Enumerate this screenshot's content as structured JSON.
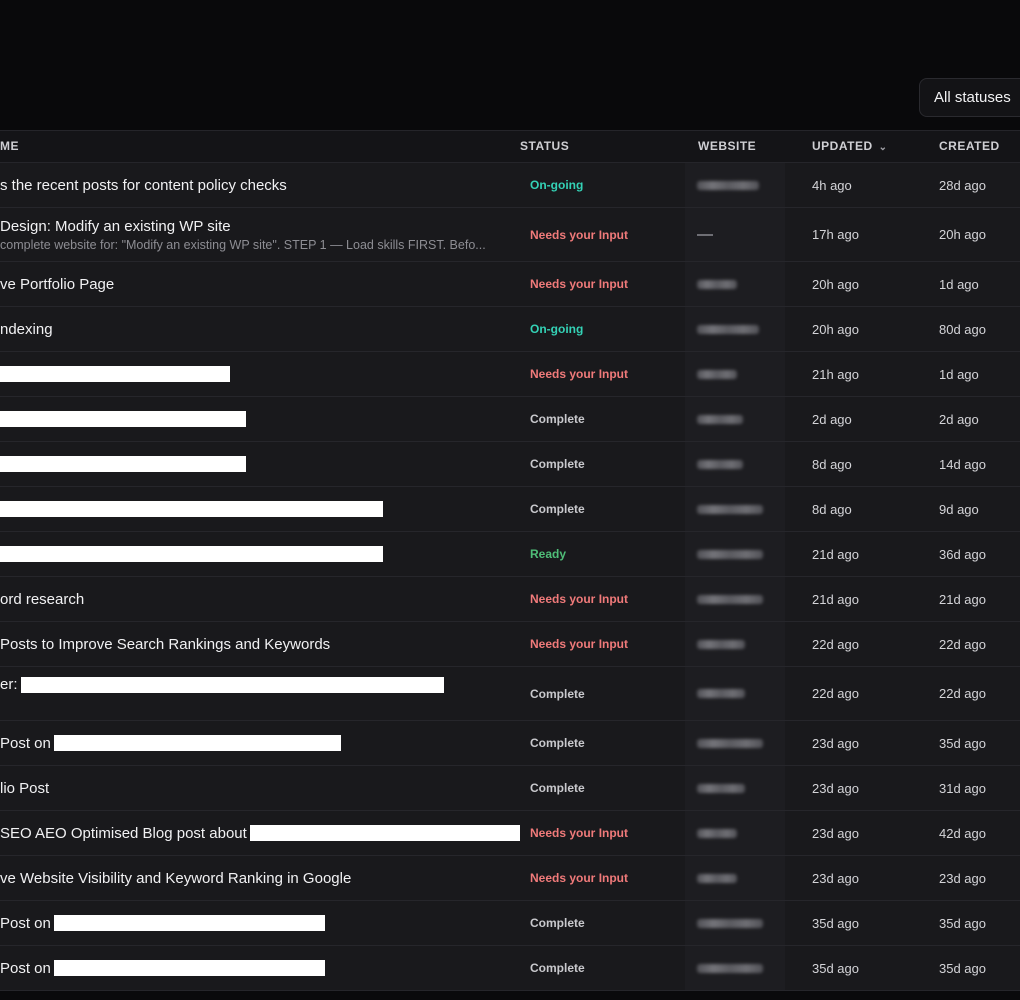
{
  "filter": {
    "label": "All statuses"
  },
  "columns": {
    "name": "ME",
    "status": "STATUS",
    "website": "WEBSITE",
    "updated": "UPDATED",
    "created": "CREATED"
  },
  "rows": [
    {
      "name": "s the recent posts for content policy checks",
      "status": "On-going",
      "status_kind": "ongoing",
      "website": "blurred",
      "updated": "4h ago",
      "created": "28d ago"
    },
    {
      "name": "Design: Modify an existing WP site",
      "sub": "complete website for: \"Modify an existing WP site\". STEP 1 — Load skills FIRST. Befo...",
      "status": "Needs your Input",
      "status_kind": "needs",
      "website": "dash",
      "updated": "17h ago",
      "created": "20h ago",
      "tall": true
    },
    {
      "name": "ve Portfolio Page",
      "status": "Needs your Input",
      "status_kind": "needs",
      "website": "blurred",
      "updated": "20h ago",
      "created": "1d ago"
    },
    {
      "name": "ndexing",
      "status": "On-going",
      "status_kind": "ongoing",
      "website": "blurred",
      "updated": "20h ago",
      "created": "80d ago"
    },
    {
      "name": "",
      "redact": 230,
      "status": "Needs your Input",
      "status_kind": "needs",
      "website": "blurred",
      "updated": "21h ago",
      "created": "1d ago"
    },
    {
      "name": "",
      "redact": 246,
      "status": "Complete",
      "status_kind": "complete",
      "website": "blurred",
      "updated": "2d ago",
      "created": "2d ago"
    },
    {
      "name": "",
      "redact": 246,
      "status": "Complete",
      "status_kind": "complete",
      "website": "blurred",
      "updated": "8d ago",
      "created": "14d ago"
    },
    {
      "name": "",
      "redact": 383,
      "status": "Complete",
      "status_kind": "complete",
      "website": "blurred",
      "updated": "8d ago",
      "created": "9d ago"
    },
    {
      "name": "",
      "redact": 383,
      "status": "Ready",
      "status_kind": "ready",
      "website": "blurred",
      "updated": "21d ago",
      "created": "36d ago"
    },
    {
      "name": "ord research",
      "status": "Needs your Input",
      "status_kind": "needs",
      "website": "blurred",
      "updated": "21d ago",
      "created": "21d ago"
    },
    {
      "name": "Posts to Improve Search Rankings and Keywords",
      "status": "Needs your Input",
      "status_kind": "needs",
      "website": "blurred",
      "updated": "22d ago",
      "created": "22d ago"
    },
    {
      "name": "er:",
      "redact": 423,
      "status": "Complete",
      "status_kind": "complete",
      "website": "blurred",
      "updated": "22d ago",
      "created": "22d ago",
      "tall": true,
      "top_aligned": true
    },
    {
      "name": "Post on",
      "redact": 287,
      "status": "Complete",
      "status_kind": "complete",
      "website": "blurred",
      "updated": "23d ago",
      "created": "35d ago"
    },
    {
      "name": "lio Post",
      "status": "Complete",
      "status_kind": "complete",
      "website": "blurred",
      "updated": "23d ago",
      "created": "31d ago"
    },
    {
      "name": "SEO AEO Optimised Blog post about",
      "redact": 270,
      "status": "Needs your Input",
      "status_kind": "needs",
      "website": "blurred",
      "updated": "23d ago",
      "created": "42d ago"
    },
    {
      "name": "ve Website Visibility and Keyword Ranking in Google",
      "status": "Needs your Input",
      "status_kind": "needs",
      "website": "blurred",
      "updated": "23d ago",
      "created": "23d ago"
    },
    {
      "name": "Post on",
      "redact": 271,
      "status": "Complete",
      "status_kind": "complete",
      "website": "blurred",
      "updated": "35d ago",
      "created": "35d ago"
    },
    {
      "name": "Post on",
      "redact": 271,
      "status": "Complete",
      "status_kind": "complete",
      "website": "blurred",
      "updated": "35d ago",
      "created": "35d ago"
    }
  ]
}
